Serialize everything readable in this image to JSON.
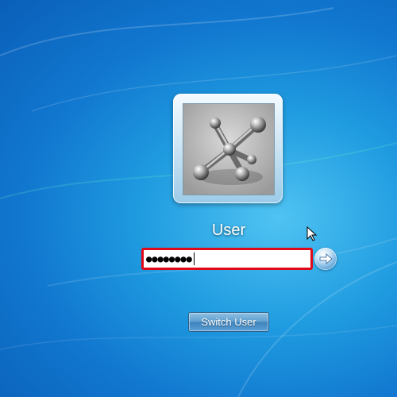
{
  "login": {
    "username": "User",
    "password_masked": "●●●●●●●●",
    "switch_user_label": "Switch User"
  },
  "icons": {
    "submit": "arrow-right-icon",
    "avatar": "metal-jacks-avatar",
    "pointer": "mouse-pointer-icon"
  },
  "colors": {
    "background_blue": "#1f9be0",
    "highlight_outline": "#e10818",
    "button_blue": "#4a8fc8"
  }
}
